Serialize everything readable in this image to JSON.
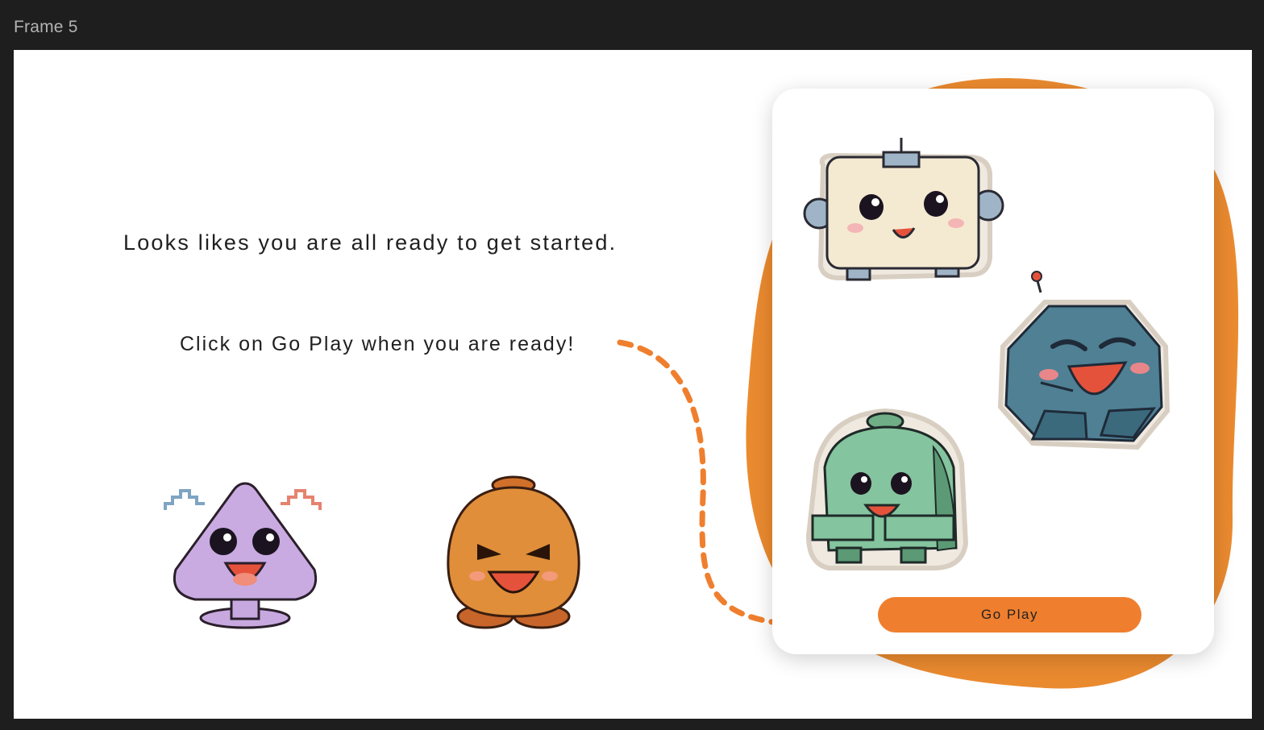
{
  "frame": {
    "title": "Frame 5"
  },
  "main": {
    "headline": "Looks likes you are all ready to get started.",
    "subline": "Click on Go Play when you are ready!"
  },
  "card": {
    "button_label": "Go Play"
  },
  "colors": {
    "accent": "#ef7f2e",
    "blob": "#ea8a2f",
    "frame_bg": "#1e1e1e",
    "canvas_bg": "#ffffff"
  },
  "icons": [
    "purple-triangle-monster-icon",
    "orange-blob-monster-icon",
    "cream-robot-icon",
    "blue-robot-icon",
    "green-robot-icon",
    "dashed-arrow-icon"
  ]
}
